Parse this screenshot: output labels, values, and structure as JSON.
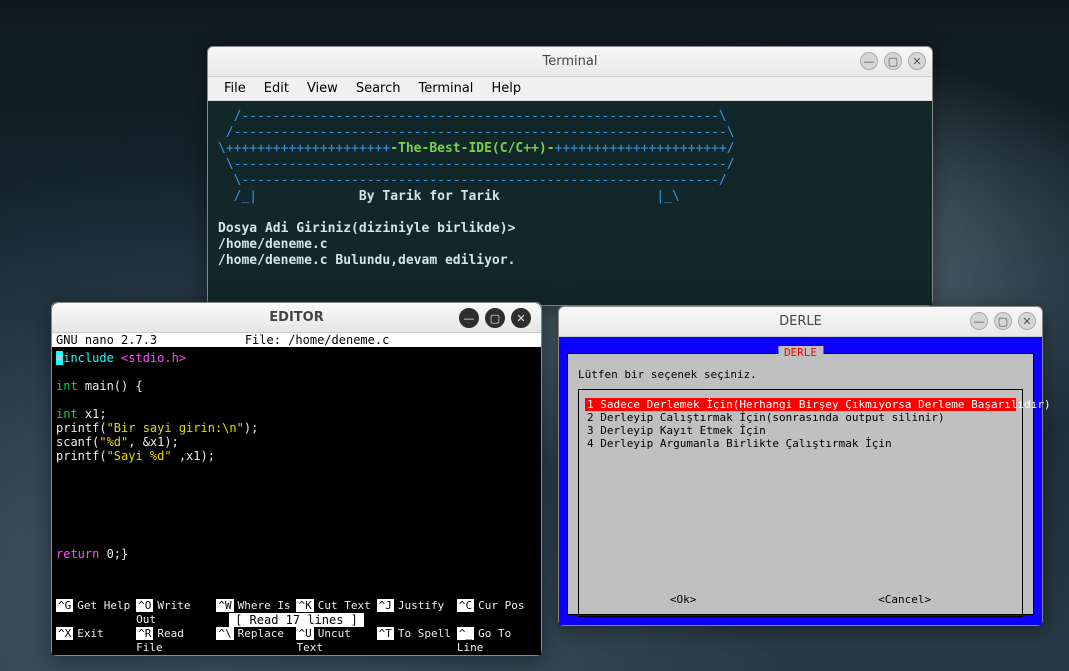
{
  "terminal": {
    "title": "Terminal",
    "menu": [
      "File",
      "Edit",
      "View",
      "Search",
      "Terminal",
      "Help"
    ],
    "banner_l1": "  /-------------------------------------------------------------\\",
    "banner_l2": " /---------------------------------------------------------------\\",
    "banner_l3a": "\\+++++++++++++++++++++",
    "banner_title": "-The-Best-IDE(C/C++)-",
    "banner_l3b": "++++++++++++++++++++++/",
    "banner_l4": " \\---------------------------------------------------------------/",
    "banner_l5": "  \\-------------------------------------------------------------/",
    "banner_l6a": "  /_|             ",
    "banner_by": "By Tarik for Tarik",
    "banner_l6b": "                    |_\\",
    "prompt": "Dosya Adi Giriniz(diziniyle birlikde)>",
    "input_path": "/home/deneme.c",
    "found_msg": "/home/deneme.c Bulundu,devam ediliyor."
  },
  "editor": {
    "title": "EDITOR",
    "nano_version": "  GNU nano 2.7.3",
    "file_label": "File: /home/deneme.c",
    "code": {
      "l1_a": "include ",
      "l1_b": "<stdio.h>",
      "l3": "int",
      "l3b": " main() {",
      "l5": "int",
      "l5b": " x1;",
      "l6a": "printf(",
      "l6b": "\"Bir sayi girin:\\n\"",
      "l6c": ");",
      "l7a": "scanf(",
      "l7b": "\"%d\"",
      "l7c": ", &x1);",
      "l8a": "printf(",
      "l8b": "\"Sayi %d\"",
      "l8c": " ,x1);",
      "l_ret": "return",
      "l_ret_b": " 0;}"
    },
    "status": "[ Read 17 lines ]",
    "shortcuts": [
      {
        "k": "^G",
        "t": "Get Help"
      },
      {
        "k": "^O",
        "t": "Write Out"
      },
      {
        "k": "^W",
        "t": "Where Is"
      },
      {
        "k": "^K",
        "t": "Cut Text"
      },
      {
        "k": "^J",
        "t": "Justify"
      },
      {
        "k": "^C",
        "t": "Cur Pos"
      },
      {
        "k": "^X",
        "t": "Exit"
      },
      {
        "k": "^R",
        "t": "Read File"
      },
      {
        "k": "^\\",
        "t": "Replace"
      },
      {
        "k": "^U",
        "t": "Uncut Text"
      },
      {
        "k": "^T",
        "t": "To Spell"
      },
      {
        "k": "^_",
        "t": "Go To Line"
      }
    ]
  },
  "derle": {
    "title": "DERLE",
    "box_label": "DERLE",
    "prompt": "Lütfen bir seçenek seçiniz.",
    "options": [
      "1 Sadece Derlemek İçin(Herhangi Birşey Çıkmıyorsa Derleme Başarılıdır)",
      "2 Derleyip Calıştırmak İçin(sonrasında output silinir)",
      "3 Derleyip Kayıt Etmek İçin",
      "4 Derleyip Argumanla Birlikte Çalıştırmak İçin"
    ],
    "ok": "<Ok>",
    "cancel": "<Cancel>"
  },
  "win_icons": {
    "min": "—",
    "max": "▢",
    "close": "✕"
  }
}
